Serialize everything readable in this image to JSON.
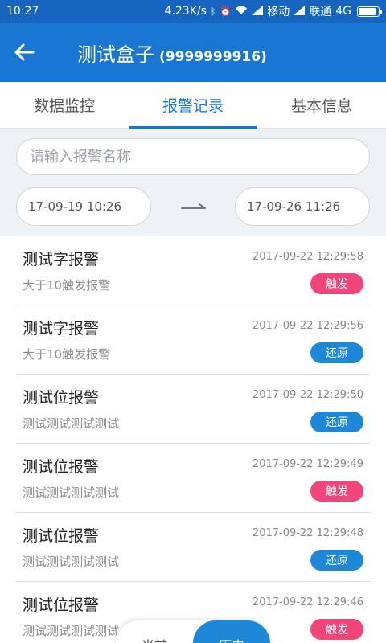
{
  "status_bar": {
    "time": "10:27",
    "speed": "4.23K/s",
    "carrier1": "移动",
    "carrier2": "联通",
    "network": "4G",
    "battery_level": 0.9
  },
  "app_bar": {
    "title": "测试盒子",
    "subtitle": "(9999999916)"
  },
  "tabs": [
    {
      "label": "数据监控",
      "active": false
    },
    {
      "label": "报警记录",
      "active": true
    },
    {
      "label": "基本信息",
      "active": false
    }
  ],
  "search": {
    "placeholder": "请输入报警名称",
    "value": ""
  },
  "date_range": {
    "start": "17-09-19 10:26",
    "end": "17-09-26 11:26"
  },
  "alarms": [
    {
      "title": "测试字报警",
      "time": "2017-09-22 12:29:58",
      "desc": "大于10触发报警",
      "status": "触发",
      "status_type": "trigger"
    },
    {
      "title": "测试字报警",
      "time": "2017-09-22 12:29:56",
      "desc": "大于10触发报警",
      "status": "还原",
      "status_type": "restore"
    },
    {
      "title": "测试位报警",
      "time": "2017-09-22 12:29:50",
      "desc": "测试测试测试测试",
      "status": "还原",
      "status_type": "restore"
    },
    {
      "title": "测试位报警",
      "time": "2017-09-22 12:29:49",
      "desc": "测试测试测试测试",
      "status": "触发",
      "status_type": "trigger"
    },
    {
      "title": "测试位报警",
      "time": "2017-09-22 12:29:48",
      "desc": "测试测试测试测试",
      "status": "还原",
      "status_type": "restore"
    },
    {
      "title": "测试位报警",
      "time": "2017-09-22 12:29:46",
      "desc": "测试测试测试测试",
      "status": "触发",
      "status_type": "trigger"
    }
  ],
  "toggle": {
    "current_label": "当前",
    "history_label": "历史"
  },
  "colors": {
    "primary": "#1976d2",
    "status_bar": "#1565c0",
    "trigger": "#f0467a",
    "restore": "#1e88d8"
  }
}
